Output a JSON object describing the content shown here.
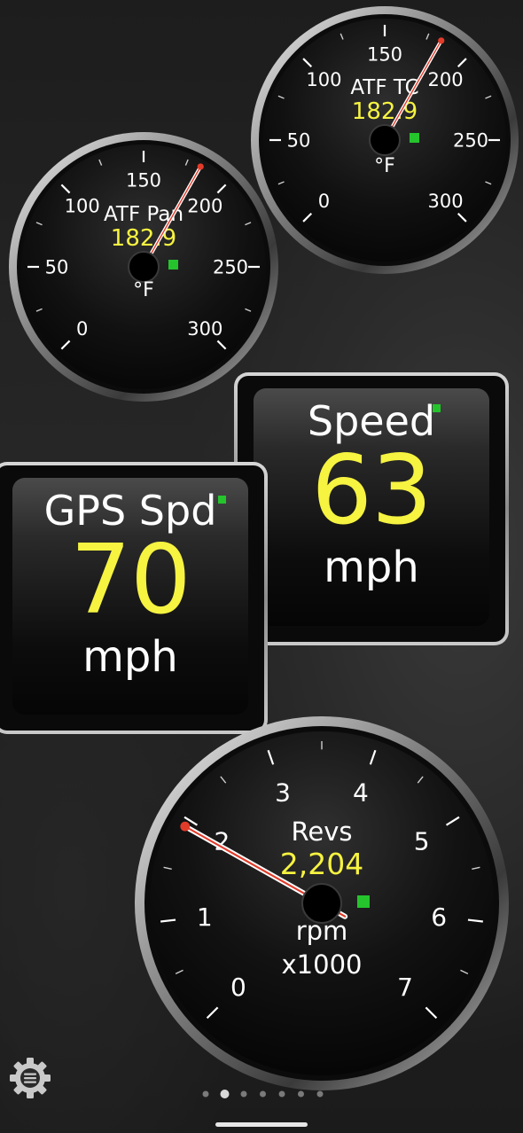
{
  "gauges": {
    "atf_tc": {
      "title": "ATF TC",
      "value": "182.9",
      "unit": "°F",
      "ticks": [
        "0",
        "50",
        "100",
        "150",
        "200",
        "250",
        "300"
      ],
      "reading": 182.9,
      "scale_min": 0,
      "scale_max": 300
    },
    "atf_pan": {
      "title": "ATF Pan",
      "value": "182.9",
      "unit": "°F",
      "ticks": [
        "0",
        "50",
        "100",
        "150",
        "200",
        "250",
        "300"
      ],
      "reading": 182.9,
      "scale_min": 0,
      "scale_max": 300
    },
    "revs": {
      "title": "Revs",
      "value": "2,204",
      "unit_line1": "rpm",
      "unit_line2": "x1000",
      "ticks": [
        "0",
        "1",
        "2",
        "3",
        "4",
        "5",
        "6",
        "7"
      ],
      "reading": 2.204,
      "scale_min": 0,
      "scale_max": 8
    }
  },
  "displays": {
    "speed": {
      "title": "Speed",
      "value": "63",
      "unit": "mph"
    },
    "gps_speed": {
      "title": "GPS Spd",
      "value": "70",
      "unit": "mph"
    }
  },
  "pager": {
    "page_count": 7,
    "active_page": 2
  },
  "icons": {
    "settings": "gear-icon"
  },
  "colors": {
    "value_yellow": "#f6f341",
    "led_green": "#25c42d",
    "needle_red": "#e23b2a"
  }
}
